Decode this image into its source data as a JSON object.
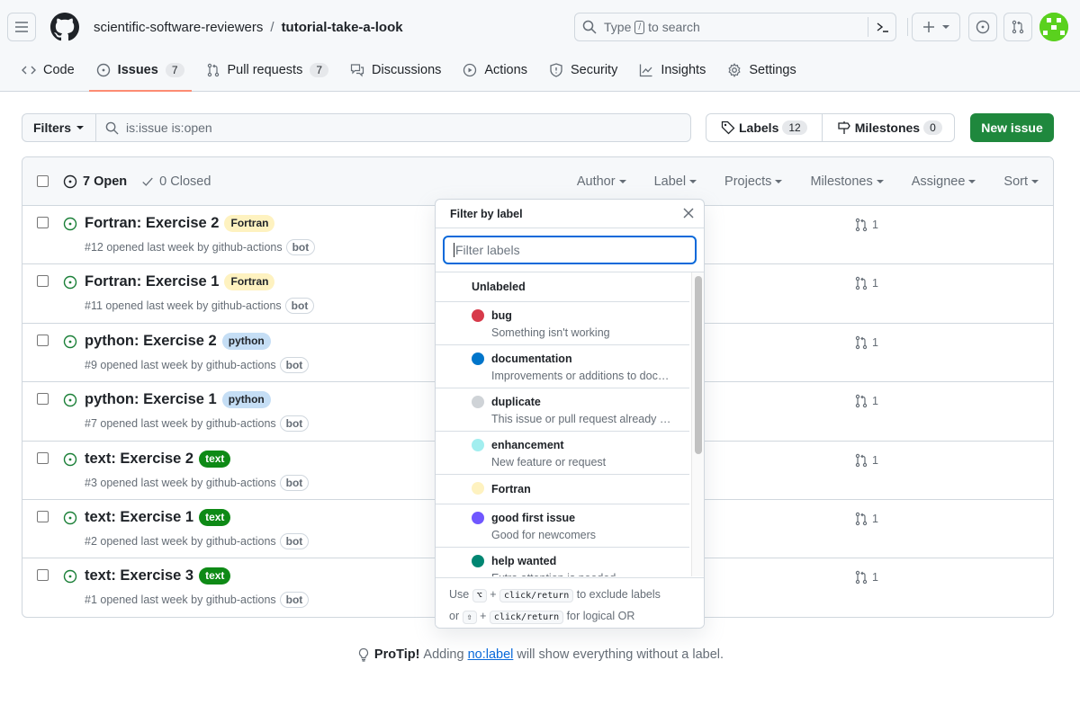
{
  "header": {
    "owner": "scientific-software-reviewers",
    "separator": "/",
    "repo": "tutorial-take-a-look",
    "search_prefix": "Type",
    "search_kbd": "/",
    "search_suffix": "to search"
  },
  "repo_nav": [
    {
      "label": "Code",
      "icon": "code-icon"
    },
    {
      "label": "Issues",
      "count": "7",
      "icon": "issue-opened-icon",
      "active": true
    },
    {
      "label": "Pull requests",
      "count": "7",
      "icon": "git-pull-request-icon"
    },
    {
      "label": "Discussions",
      "icon": "comment-discussion-icon"
    },
    {
      "label": "Actions",
      "icon": "play-icon"
    },
    {
      "label": "Security",
      "icon": "shield-icon"
    },
    {
      "label": "Insights",
      "icon": "graph-icon"
    },
    {
      "label": "Settings",
      "icon": "gear-icon"
    }
  ],
  "subnav": {
    "filters_label": "Filters",
    "query": "is:issue is:open",
    "labels_label": "Labels",
    "labels_count": "12",
    "milestones_label": "Milestones",
    "milestones_count": "0",
    "new_issue_label": "New issue"
  },
  "list_header": {
    "open_label": "7 Open",
    "closed_label": "0 Closed",
    "sorts": [
      "Author",
      "Label",
      "Projects",
      "Milestones",
      "Assignee",
      "Sort"
    ]
  },
  "issues": [
    {
      "title": "Fortran: Exercise 2",
      "label": "Fortran",
      "label_bg": "#fef2c0",
      "label_fg": "#1f2328",
      "meta": "#12 opened last week by github-actions",
      "badge": "bot",
      "linked_prs": "1"
    },
    {
      "title": "Fortran: Exercise 1",
      "label": "Fortran",
      "label_bg": "#fef2c0",
      "label_fg": "#1f2328",
      "meta": "#11 opened last week by github-actions",
      "badge": "bot",
      "linked_prs": "1"
    },
    {
      "title": "python: Exercise 2",
      "label": "python",
      "label_bg": "#c5def5",
      "label_fg": "#1f2328",
      "meta": "#9 opened last week by github-actions",
      "badge": "bot",
      "linked_prs": "1"
    },
    {
      "title": "python: Exercise 1",
      "label": "python",
      "label_bg": "#c5def5",
      "label_fg": "#1f2328",
      "meta": "#7 opened last week by github-actions",
      "badge": "bot",
      "linked_prs": "1"
    },
    {
      "title": "text: Exercise 2",
      "label": "text",
      "label_bg": "#0e8a16",
      "label_fg": "#ffffff",
      "meta": "#3 opened last week by github-actions",
      "badge": "bot",
      "linked_prs": "1"
    },
    {
      "title": "text: Exercise 1",
      "label": "text",
      "label_bg": "#0e8a16",
      "label_fg": "#ffffff",
      "meta": "#2 opened last week by github-actions",
      "badge": "bot",
      "linked_prs": "1"
    },
    {
      "title": "text: Exercise 3",
      "label": "text",
      "label_bg": "#0e8a16",
      "label_fg": "#ffffff",
      "meta": "#1 opened last week by github-actions",
      "badge": "bot",
      "linked_prs": "1"
    }
  ],
  "label_dropdown": {
    "title": "Filter by label",
    "placeholder": "Filter labels",
    "unlabeled": "Unlabeled",
    "items": [
      {
        "name": "bug",
        "desc": "Something isn't working",
        "color": "#d73a4a"
      },
      {
        "name": "documentation",
        "desc": "Improvements or additions to doc…",
        "color": "#0075ca"
      },
      {
        "name": "duplicate",
        "desc": "This issue or pull request already …",
        "color": "#cfd3d7"
      },
      {
        "name": "enhancement",
        "desc": "New feature or request",
        "color": "#a2eeef"
      },
      {
        "name": "Fortran",
        "desc": "",
        "color": "#fef2c0"
      },
      {
        "name": "good first issue",
        "desc": "Good for newcomers",
        "color": "#7057ff"
      },
      {
        "name": "help wanted",
        "desc": "Extra attention is needed",
        "color": "#008672"
      }
    ],
    "footer_line1_pre": "Use",
    "footer_key1": "⌥",
    "footer_plus": "+",
    "footer_click": "click/return",
    "footer_line1_post": "to exclude labels",
    "footer_line2_pre": "or",
    "footer_key2": "⇧",
    "footer_line2_post": "for logical OR"
  },
  "protip": {
    "bold": "ProTip!",
    "pre": "Adding",
    "link": "no:label",
    "post": "will show everything without a label."
  },
  "colors": {
    "accent": "#0969da",
    "primary_button": "#1f883d",
    "open_icon": "#1a7f37",
    "active_tab_underline": "#fd8c73"
  }
}
